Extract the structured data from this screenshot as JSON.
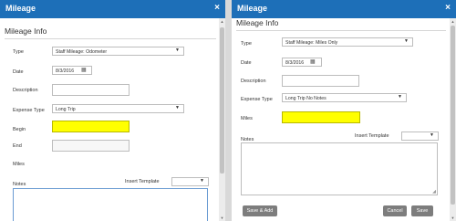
{
  "colors": {
    "titlebar": "#1d6fb8",
    "highlight": "#ffff00",
    "button": "#7d7d7d"
  },
  "icons": {
    "close": "close-icon",
    "calendar": "calendar-icon",
    "dropdown": "chevron-down-icon"
  },
  "left_dialog": {
    "title": "Mileage",
    "close_glyph": "×",
    "section": "Mileage Info",
    "type_label": "Type",
    "type_value": "Staff Mileage: Odometer",
    "date_label": "Date",
    "date_value": "8/3/2016",
    "description_label": "Description",
    "description_value": "",
    "expense_type_label": "Expense Type",
    "expense_type_value": "Long Trip",
    "begin_label": "Begin",
    "begin_value": "",
    "end_label": "End",
    "end_value": "",
    "miles_label": "Miles",
    "notes_label": "Notes",
    "insert_template_label": "Insert Template",
    "insert_template_value": ""
  },
  "right_dialog": {
    "title": "Mileage",
    "close_glyph": "×",
    "section": "Mileage Info",
    "type_label": "Type",
    "type_value": "Staff Mileage: Miles Only",
    "date_label": "Date",
    "date_value": "8/3/2016",
    "description_label": "Description",
    "description_value": "",
    "expense_type_label": "Expense Type",
    "expense_type_value": "Long Trip No Notes",
    "miles_label": "Miles",
    "miles_value": "",
    "notes_label": "Notes",
    "insert_template_label": "Insert Template",
    "insert_template_value": "",
    "save_add_label": "Save & Add",
    "cancel_label": "Cancel",
    "save_label": "Save"
  }
}
